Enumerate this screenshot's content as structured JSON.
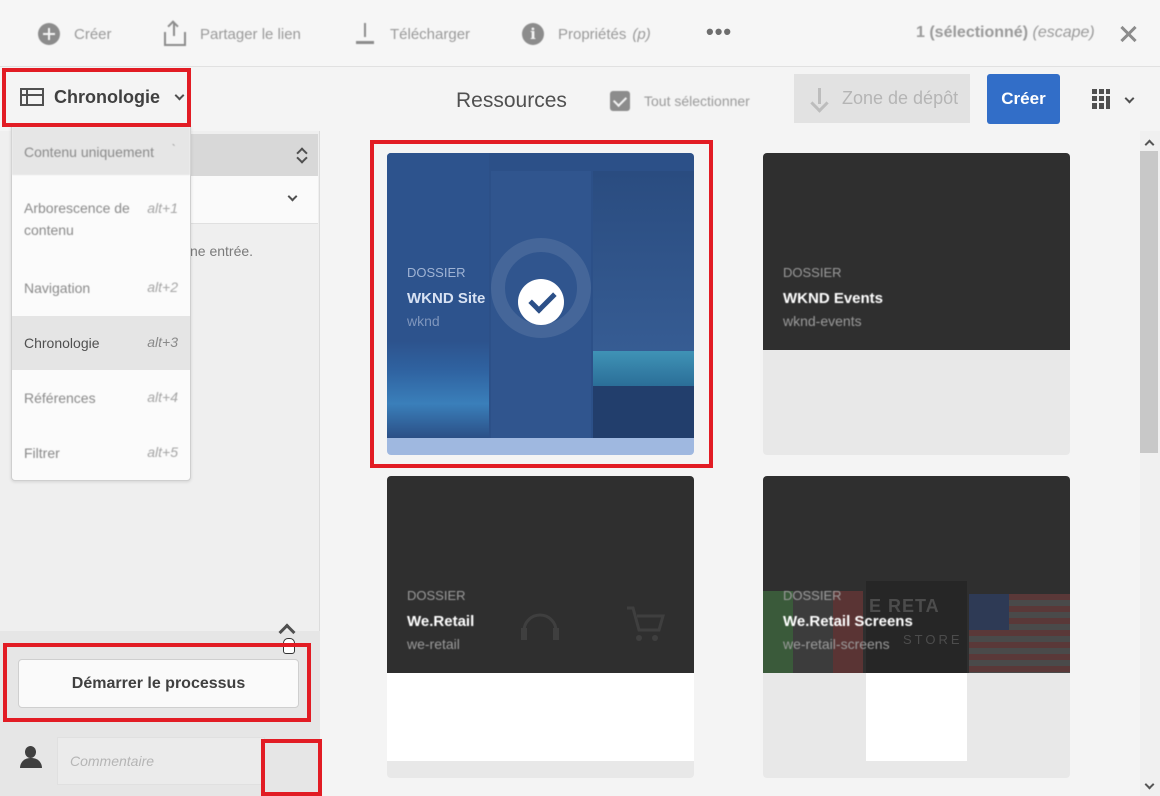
{
  "actionbar": {
    "create": "Créer",
    "share": "Partager le lien",
    "download": "Télécharger",
    "properties": "Propriétés",
    "properties_key": "(p)",
    "more": "•••",
    "selection": "1 (sélectionné)",
    "selection_key": "(escape)"
  },
  "toolbar": {
    "rail_label": "Chronologie",
    "title": "Ressources",
    "select_all": "Tout sélectionner",
    "dropzone": "Zone de dépôt",
    "create": "Créer"
  },
  "menu": {
    "items": [
      {
        "label": "Contenu uniquement",
        "key": "`"
      },
      {
        "label": "Arborescence de contenu",
        "key": "alt+1"
      },
      {
        "label": "Navigation",
        "key": "alt+2"
      },
      {
        "label": "Chronologie",
        "key": "alt+3"
      },
      {
        "label": "Références",
        "key": "alt+4"
      },
      {
        "label": "Filtrer",
        "key": "alt+5"
      }
    ]
  },
  "rail": {
    "message": "ne entrée.",
    "start_button": "Démarrer le processus",
    "comment_placeholder": "Commentaire"
  },
  "cards": [
    {
      "type": "DOSSIER",
      "name": "WKND Site",
      "path": "wknd",
      "selected": true
    },
    {
      "type": "DOSSIER",
      "name": "WKND Events",
      "path": "wknd-events",
      "selected": false
    },
    {
      "type": "DOSSIER",
      "name": "We.Retail",
      "path": "we-retail",
      "selected": false
    },
    {
      "type": "DOSSIER",
      "name": "We.Retail Screens",
      "path": "we-retail-screens",
      "selected": false
    }
  ],
  "thumb_text": {
    "retail_screens_overlay": "E RETA",
    "retail_screens_overlay2": "STORE"
  },
  "colors": {
    "accent": "#326ec8",
    "selected_card": "#2c5088",
    "highlight": "#e21c24"
  },
  "icons": [
    "add-circle-icon",
    "share-icon",
    "download-icon",
    "info-icon",
    "close-icon",
    "panel-icon",
    "chevron-down-icon",
    "select-checkbox-icon",
    "arrow-down-icon",
    "grid-view-icon",
    "user-icon",
    "chevron-up-icon",
    "hand-cursor-icon",
    "checkmark-icon"
  ]
}
